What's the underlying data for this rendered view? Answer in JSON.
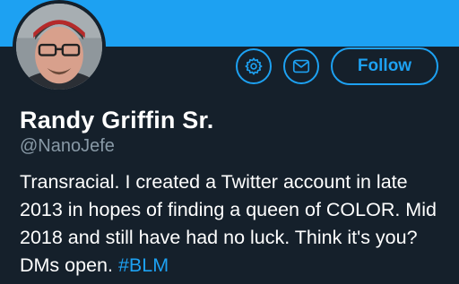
{
  "profile": {
    "name": "Randy Griffin Sr.",
    "handle": "@NanoJefe",
    "bio_text": "Transracial. I created a Twitter account in late 2013 in hopes of finding a queen of COLOR. Mid 2018 and still have had no luck. Think it's you? DMs open.",
    "bio_hashtag": "#BLM"
  },
  "actions": {
    "follow_label": "Follow",
    "settings_icon": "gear-icon",
    "message_icon": "envelope-icon"
  },
  "colors": {
    "background": "#15202b",
    "banner": "#1da1f2",
    "accent": "#1da1f2",
    "secondary_text": "#8899a6"
  }
}
